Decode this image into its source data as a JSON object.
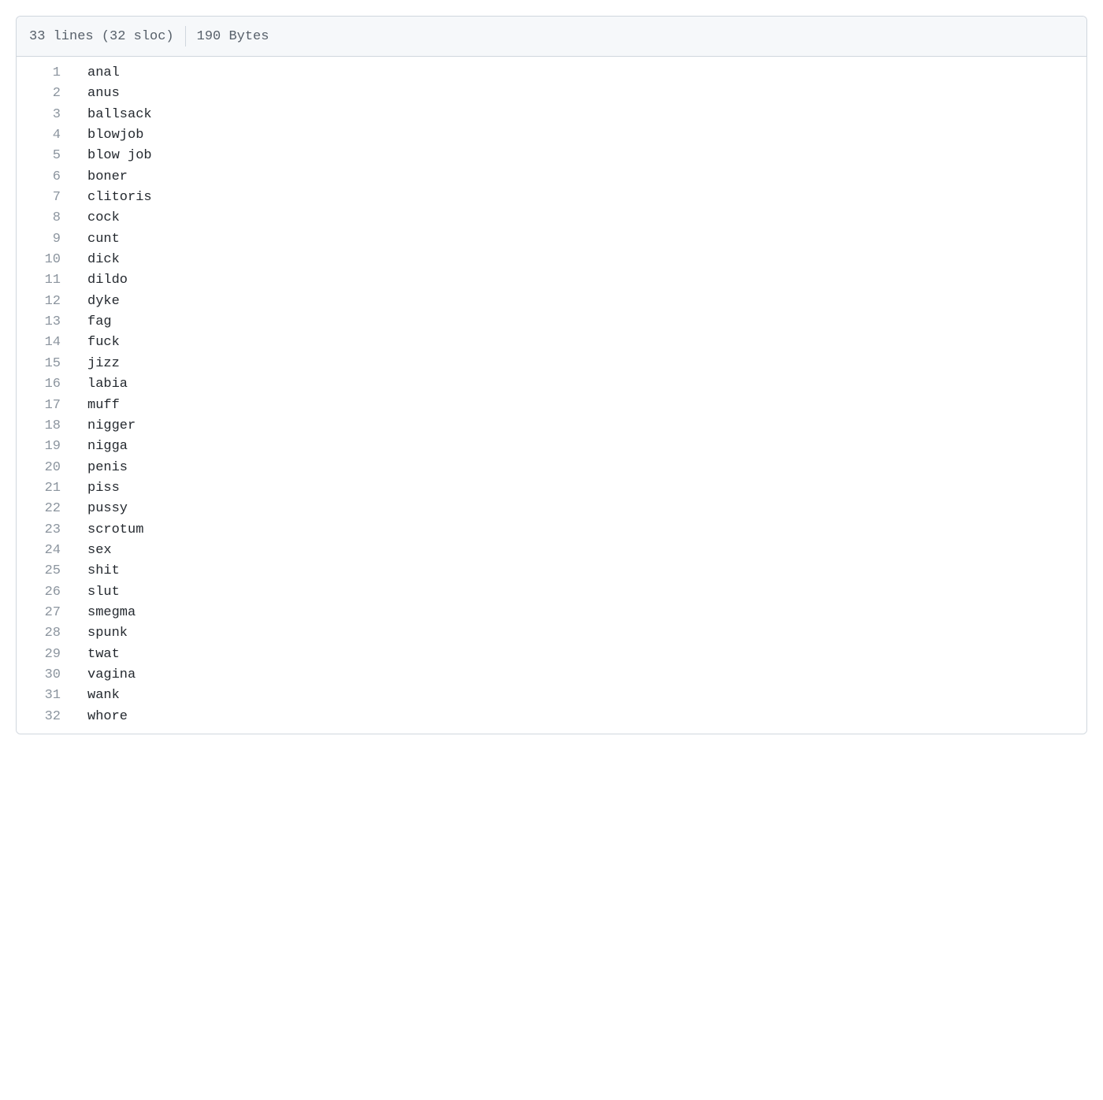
{
  "header": {
    "lines_label": "33 lines (32 sloc)",
    "size_label": "190 Bytes"
  },
  "lines": [
    "anal",
    "anus",
    "ballsack",
    "blowjob",
    "blow job",
    "boner",
    "clitoris",
    "cock",
    "cunt",
    "dick",
    "dildo",
    "dyke",
    "fag",
    "fuck",
    "jizz",
    "labia",
    "muff",
    "nigger",
    "nigga",
    "penis",
    "piss",
    "pussy",
    "scrotum",
    "sex",
    "shit",
    "slut",
    "smegma",
    "spunk",
    "twat",
    "vagina",
    "wank",
    "whore"
  ]
}
